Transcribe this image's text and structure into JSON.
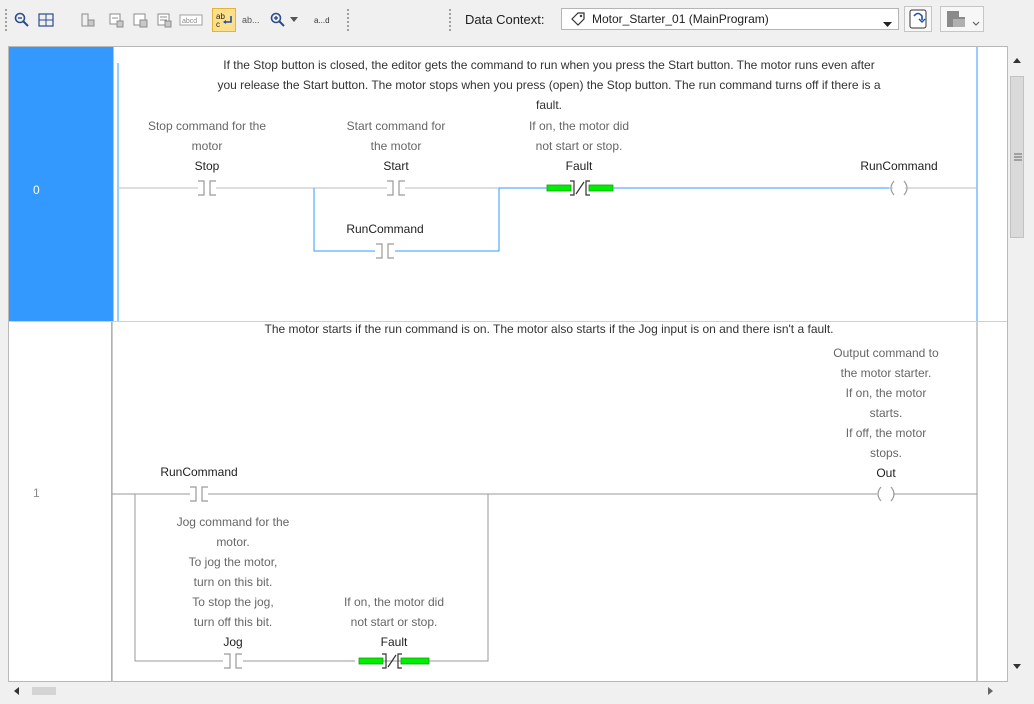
{
  "toolbar": {
    "icons": [
      "zoom-out-icon",
      "fit-icon",
      "select-icon",
      "add-rung-icon",
      "add-branch-icon",
      "add-level-icon",
      "add-instruction-icon",
      "toggle-text-icon",
      "show-tag-icon",
      "zoom-in-icon",
      "zoom-dropdown-icon",
      "abbrev-icon",
      "properties-icon",
      "online-icon"
    ],
    "data_context_label": "Data Context:",
    "data_context_value": "Motor_Starter_01 (MainProgram)"
  },
  "rungs": [
    {
      "number": "0",
      "comment_lines": [
        "If the Stop button is closed, the editor gets the command to run when you press the Start button. The motor runs even after",
        "you release the Start button. The motor stops when you press (open) the Stop button. The run command turns off if there is a",
        "fault."
      ],
      "stop": {
        "desc": [
          "Stop command for the",
          "motor"
        ],
        "tag": "Stop"
      },
      "start": {
        "desc": [
          "Start command for",
          "the motor"
        ],
        "tag": "Start"
      },
      "fault": {
        "desc": [
          "If on, the motor did",
          "not start or stop."
        ],
        "tag": "Fault"
      },
      "runcmd_branch": {
        "tag": "RunCommand"
      },
      "coil": {
        "tag": "RunCommand"
      }
    },
    {
      "number": "1",
      "comment_lines": [
        "The motor starts if the run command is on. The motor also starts if the Jog input is on and there isn't a fault."
      ],
      "runcmd": {
        "tag": "RunCommand"
      },
      "jog": {
        "desc": [
          "Jog command for the",
          "motor.",
          "To jog the motor,",
          "turn on this bit.",
          "To stop the jog,",
          "turn off this bit."
        ],
        "tag": "Jog"
      },
      "fault": {
        "desc": [
          "If on, the motor did",
          "not start or stop."
        ],
        "tag": "Fault"
      },
      "coil": {
        "desc": [
          "Output command to",
          "the motor starter.",
          "If on, the motor",
          "starts.",
          "If off, the motor",
          "stops."
        ],
        "tag": "Out"
      }
    }
  ],
  "colors": {
    "selected_rung": "#3399ff",
    "wire_active": "#3399ff",
    "energized": "#00ee00"
  }
}
